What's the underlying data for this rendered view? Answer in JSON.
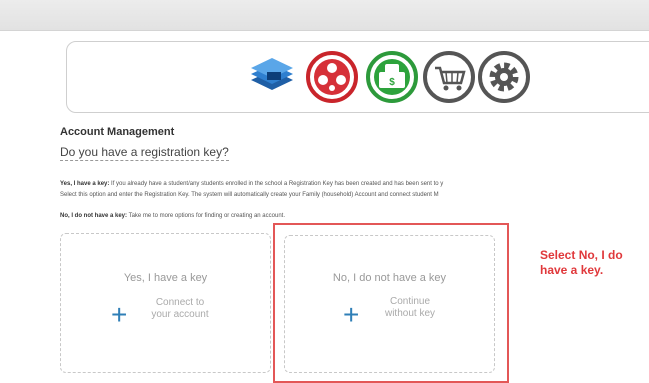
{
  "nav": {
    "icons": [
      "layers-icon",
      "soccer-ball-icon",
      "money-icon",
      "shopping-cart-icon",
      "gear-icon"
    ]
  },
  "account": {
    "title": "Account Management",
    "question": "Do you have a registration key?"
  },
  "info": {
    "yes_label": "Yes, I have a key:",
    "yes_text": " If you already have a student/any students enrolled in the school a Registration Key has been created and has been sent to y",
    "yes_text2": "Select this option and enter the Registration Key. The system will automatically create your Family (household) Account and connect student M",
    "no_label": "No, I do not have a key:",
    "no_text": " Take me to more options for finding or creating an account."
  },
  "options": {
    "yes": {
      "title": "Yes, I have a key",
      "sub1": "Connect to",
      "sub2": "your account"
    },
    "no": {
      "title": "No, I do not have a key",
      "sub1": "Continue",
      "sub2": "without key"
    }
  },
  "annotation": {
    "line1": "Select No, I do",
    "line2": "have a key."
  },
  "colors": {
    "accent_blue": "#2f7fb7",
    "annotation_red": "#e0383b"
  }
}
